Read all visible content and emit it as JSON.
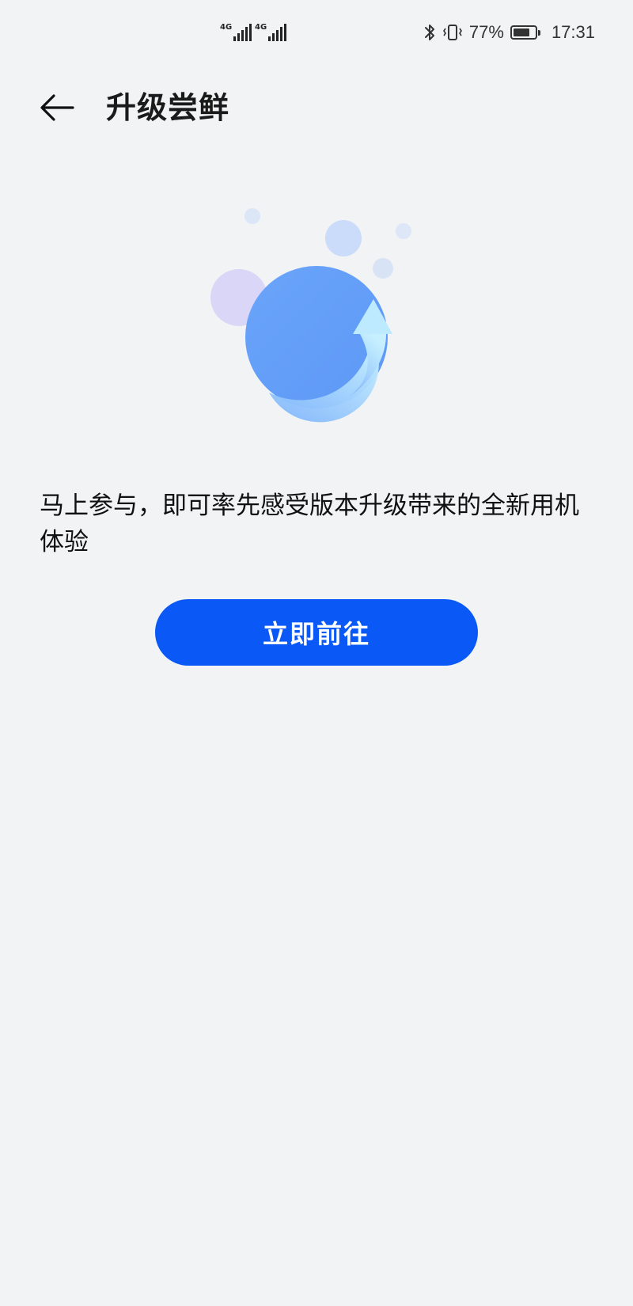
{
  "status_bar": {
    "sim1_net": "4G",
    "sim2_net": "4G",
    "battery_percent": "77%",
    "battery_level": 0.77,
    "time": "17:31",
    "icons": [
      "bluetooth-icon",
      "vibrate-icon",
      "battery-icon"
    ]
  },
  "header": {
    "title": "升级尝鲜",
    "back_icon": "back-arrow-icon"
  },
  "main": {
    "description": "马上参与，即可率先感受版本升级带来的全新用机体验",
    "cta_label": "立即前往"
  },
  "colors": {
    "background": "#f1f3f5",
    "accent": "#0a59f7",
    "orb": "#67a1f8",
    "arrow_light": "#bfe7ff"
  }
}
